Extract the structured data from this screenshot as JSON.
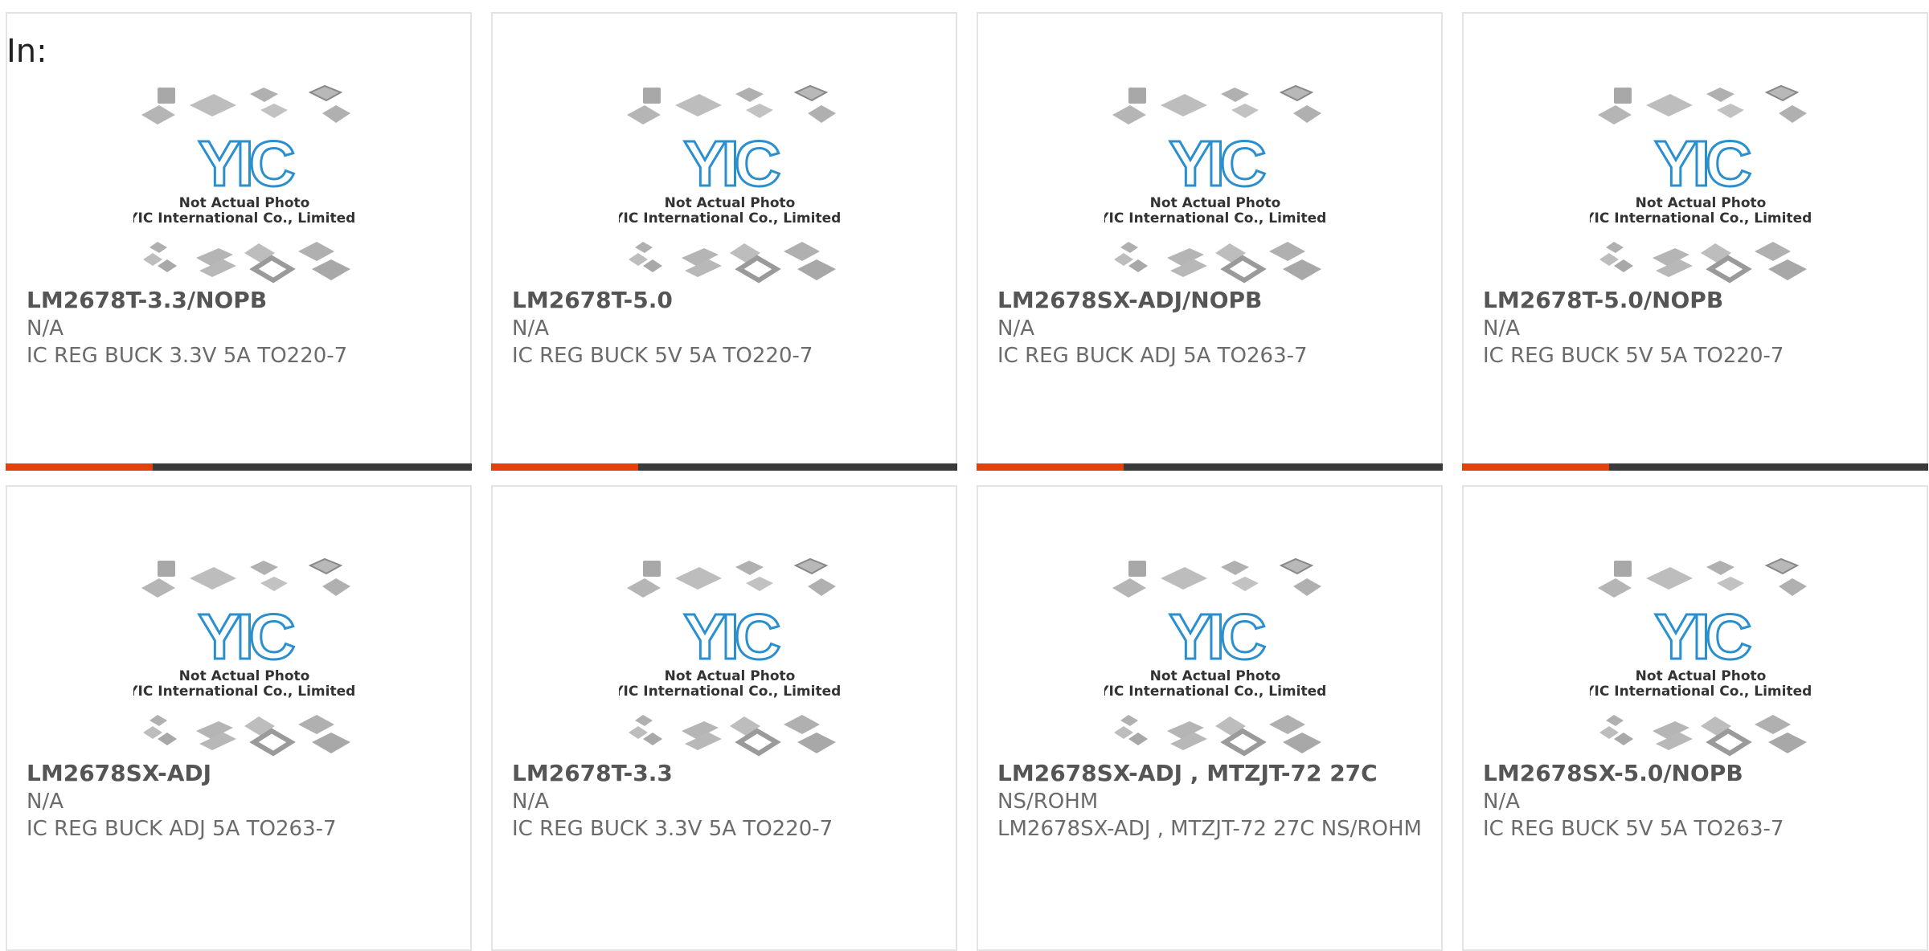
{
  "page_label": "In:",
  "image_caption": {
    "line1": "Not Actual Photo",
    "line2": "YIC International Co., Limited.",
    "logo": "YIC"
  },
  "accent_color": "#e63f0e",
  "bar_color": "#3a3a3a",
  "products": [
    {
      "part": "LM2678T-3.3/NOPB",
      "manufacturer": "N/A",
      "description": "IC REG BUCK 3.3V 5A TO220-7"
    },
    {
      "part": "LM2678T-5.0",
      "manufacturer": "N/A",
      "description": "IC REG BUCK 5V 5A TO220-7"
    },
    {
      "part": "LM2678SX-ADJ/NOPB",
      "manufacturer": "N/A",
      "description": "IC REG BUCK ADJ 5A TO263-7"
    },
    {
      "part": "LM2678T-5.0/NOPB",
      "manufacturer": "N/A",
      "description": "IC REG BUCK 5V 5A TO220-7"
    },
    {
      "part": "LM2678SX-ADJ",
      "manufacturer": "N/A",
      "description": "IC REG BUCK ADJ 5A TO263-7"
    },
    {
      "part": "LM2678T-3.3",
      "manufacturer": "N/A",
      "description": "IC REG BUCK 3.3V 5A TO220-7"
    },
    {
      "part": "LM2678SX-ADJ , MTZJT-72 27C",
      "manufacturer": "NS/ROHM",
      "description": "LM2678SX-ADJ , MTZJT-72 27C NS/ROHM"
    },
    {
      "part": "LM2678SX-5.0/NOPB",
      "manufacturer": "N/A",
      "description": "IC REG BUCK 5V 5A TO263-7"
    }
  ]
}
